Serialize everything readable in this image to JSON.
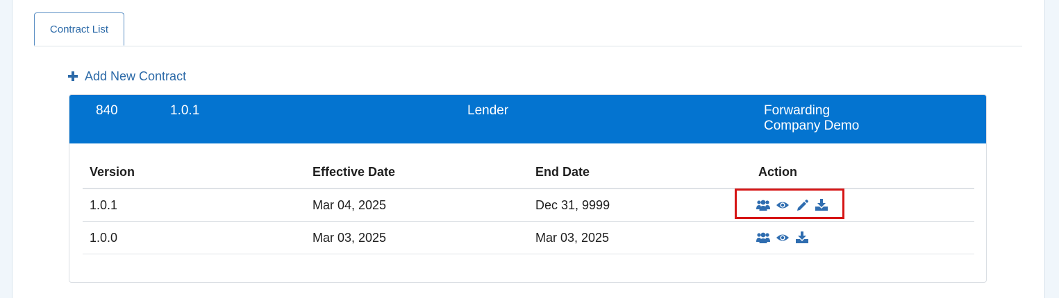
{
  "tabs": [
    {
      "label": "Contract List"
    }
  ],
  "add_contract": {
    "label": "Add New Contract",
    "icon": "plus-icon"
  },
  "contract_header": {
    "id": "840",
    "version": "1.0.1",
    "role": "Lender",
    "company": "Forwarding Company Demo"
  },
  "table": {
    "columns": [
      "Version",
      "Effective Date",
      "End Date",
      "Action"
    ],
    "rows": [
      {
        "version": "1.0.1",
        "effective_date": "Mar 04, 2025",
        "end_date": "Dec 31, 9999",
        "actions": [
          "users-icon",
          "eye-icon",
          "pencil-icon",
          "download-icon"
        ],
        "highlighted": true
      },
      {
        "version": "1.0.0",
        "effective_date": "Mar 03, 2025",
        "end_date": "Mar 03, 2025",
        "actions": [
          "users-icon",
          "eye-icon",
          "download-icon"
        ],
        "highlighted": false
      }
    ]
  },
  "colors": {
    "header_bg": "#0474d0",
    "link": "#2c6aa8",
    "icon": "#2f6db0",
    "highlight": "#d61515"
  }
}
